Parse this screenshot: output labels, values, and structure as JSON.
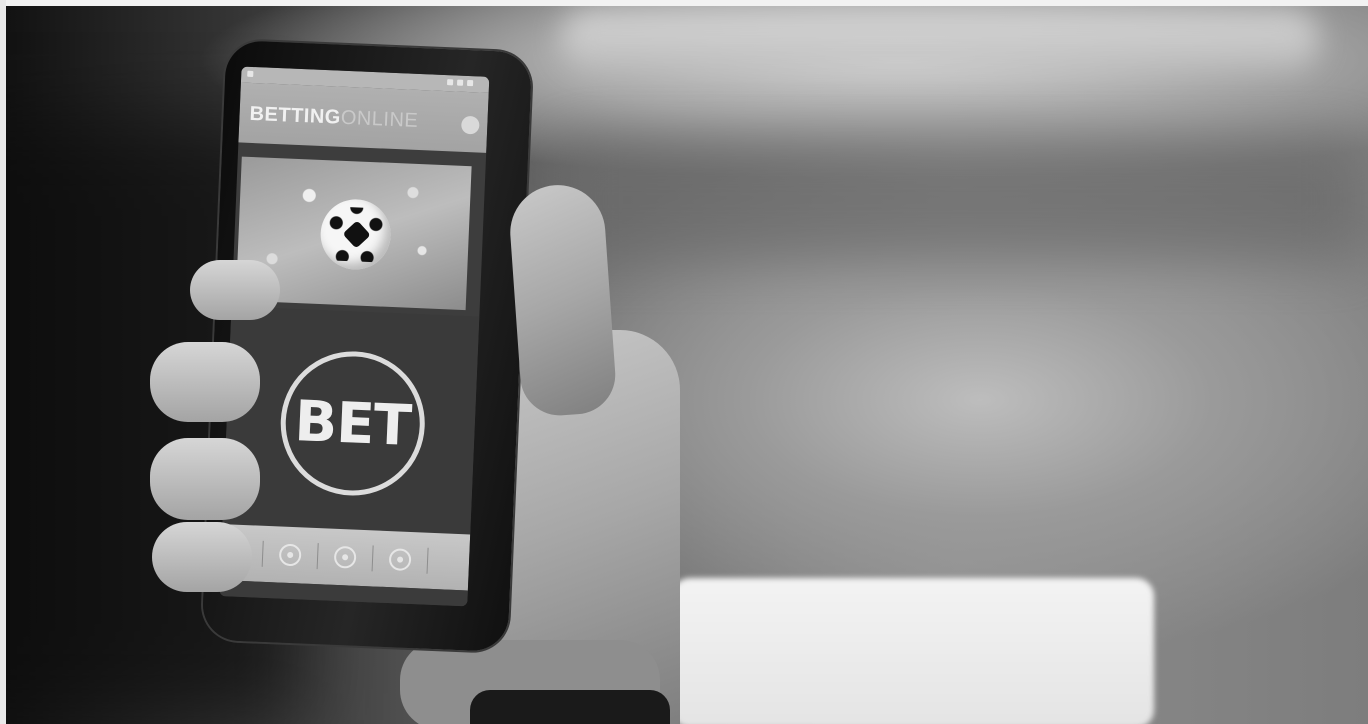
{
  "app": {
    "title_bold": "BETTING",
    "title_light": "ONLINE",
    "bet_label": "BET"
  },
  "icons": {
    "menu": "menu-circle-icon",
    "footer": [
      "back-icon",
      "search-icon",
      "settings-icon"
    ]
  },
  "colors": {
    "image_mode": "grayscale"
  }
}
